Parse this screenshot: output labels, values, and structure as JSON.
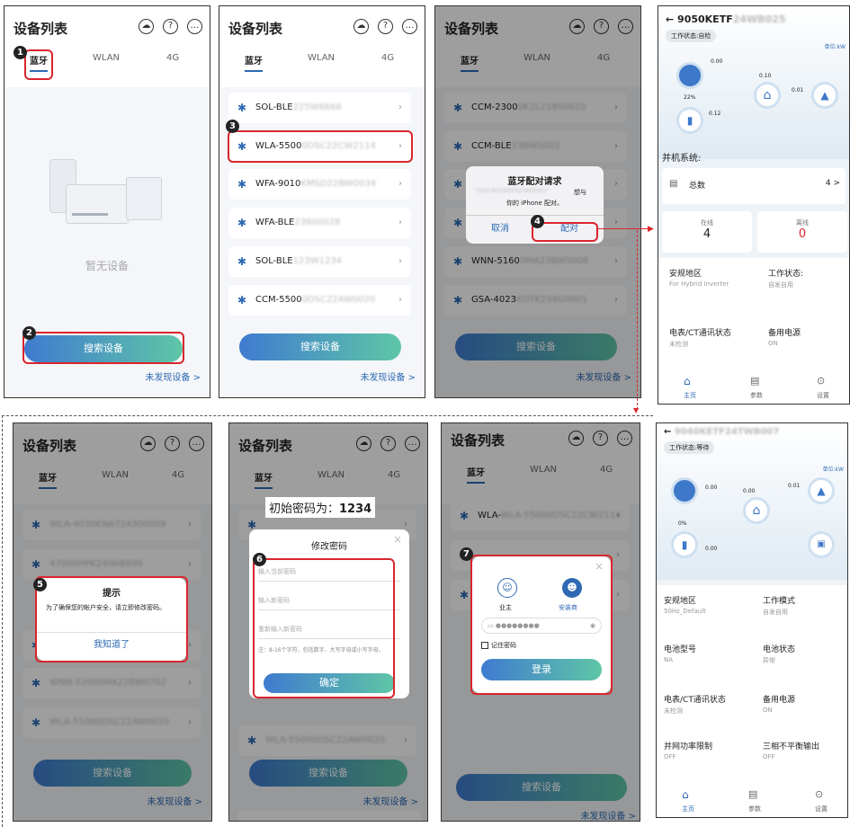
{
  "header": {
    "title": "设备列表"
  },
  "tabs": {
    "bt": "蓝牙",
    "wlan": "WLAN",
    "g4": "4G"
  },
  "panel1": {
    "empty": "暂无设备",
    "search": "搜索设备",
    "notfound": "未发现设备 >"
  },
  "panel2": {
    "devices": [
      {
        "prefix": "SOL-BLE",
        "blur": "225W6666"
      },
      {
        "prefix": "WLA-5500",
        "blur": "0DSC22CW2114"
      },
      {
        "prefix": "WFA-9010",
        "blur": "KMSD22BW0034"
      },
      {
        "prefix": "WFA-BLE",
        "blur": "23600028"
      },
      {
        "prefix": "SOL-BLE",
        "blur": "123W1234"
      },
      {
        "prefix": "CCM-5500",
        "blur": "0DSC22AW0020"
      }
    ]
  },
  "panel3": {
    "devices": [
      {
        "prefix": "CCM-2300",
        "blur": "0K2L21BS0020"
      },
      {
        "prefix": "CCM-BLE",
        "blur": "238WS002"
      },
      {
        "prefix": "WNN-5160",
        "blur": "0MA23BWS008"
      },
      {
        "prefix": "GSA-4023",
        "blur": "KDTK234G0001"
      }
    ],
    "dialog_title": "蓝牙配对请求",
    "dialog_blur": "\"GSA-4023KDTK234G0001\"",
    "dialog_l1": "想与",
    "dialog_l2": "你的 iPhone 配对。",
    "cancel": "取消",
    "pair": "配对"
  },
  "panel4": {
    "title": "9050KETF",
    "title_blur": "24WB025",
    "status": "工作状态:自检",
    "unit": "单位:kW",
    "v1": "0.00",
    "v2": "0.10",
    "v3": "0.01",
    "v4": "22%",
    "v5": "0.12",
    "section": "并机系统:",
    "total": "总数",
    "total_val": "4 >",
    "online": "在线",
    "online_val": "4",
    "offline": "离线",
    "offline_val": "0",
    "r1a": "安规地区",
    "r1a_v": "For Hybrid Inverter",
    "r1b": "工作状态:",
    "r1b_v": "自发自用",
    "r2a": "电表/CT通讯状态",
    "r2a_v": "未检测",
    "r2b": "备用电源",
    "r2b_v": "ON",
    "nav": [
      "主页",
      "参数",
      "设置"
    ]
  },
  "panel5": {
    "devices": [
      "WLA-4030KNA724300009",
      "47000HPK24IWB999",
      "WLA-4030KNA724300009",
      "WNN-52000MA22BW0702",
      "WLA-55000DSC22AW0020"
    ],
    "title": "提示",
    "msg": "为了确保您的帐户安全，请立即修改密码。",
    "ok": "我知道了",
    "search": "搜索设备",
    "notfound": "未发现设备 >"
  },
  "panel6": {
    "banner_l": "初始密码为：",
    "banner_v": "1234",
    "title": "修改密码",
    "p1": "输入当前密码",
    "p2": "输入新密码",
    "p3": "重新输入新密码",
    "hint": "注：8-16个字符，包括数字、大写字母或小写字母。",
    "ok": "确定",
    "last": "WLA-55000DSC22AW0020",
    "search": "搜索设备",
    "notfound": "未发现设备 >"
  },
  "panel7": {
    "dev1": "WLA-55000DSC22CW2114",
    "owner": "业主",
    "installer": "安装商",
    "pwd": "●●●●●●●●",
    "remember": "记住密码",
    "login": "登录",
    "search": "搜索设备",
    "notfound": "未发现设备 >"
  },
  "panel8": {
    "title": "9040KETF24TWB007",
    "status": "工作状态:等待",
    "unit": "单位:kW",
    "v1": "0.00",
    "v2": "0.00",
    "v3": "0.01",
    "v4": "0%",
    "v5": "0.00",
    "rows": [
      {
        "a": "安规地区",
        "av": "50Hz_Default",
        "b": "工作模式",
        "bv": "自发自用"
      },
      {
        "a": "电池型号",
        "av": "NA",
        "b": "电池状态",
        "bv": "异常"
      },
      {
        "a": "电表/CT通讯状态",
        "av": "未检测",
        "b": "备用电源",
        "bv": "ON"
      },
      {
        "a": "并网功率限制",
        "av": "OFF",
        "b": "三相不平衡输出",
        "bv": "OFF"
      }
    ],
    "nav": [
      "主页",
      "参数",
      "设置"
    ]
  },
  "steps": [
    "1",
    "2",
    "3",
    "4",
    "5",
    "6",
    "7"
  ]
}
